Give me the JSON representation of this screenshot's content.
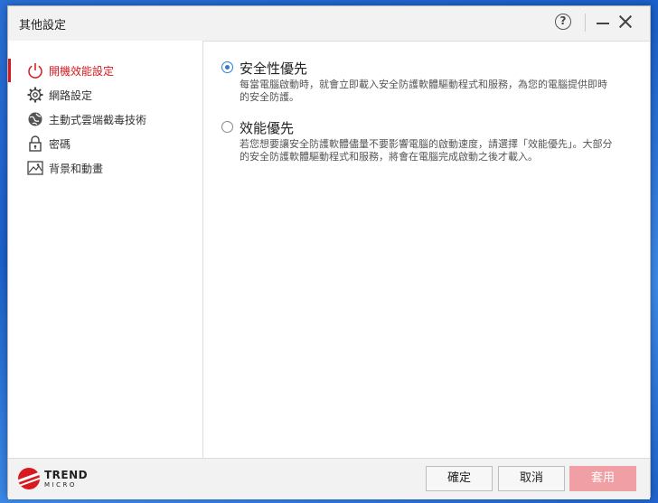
{
  "window": {
    "title": "其他設定"
  },
  "sidebar": {
    "items": [
      {
        "label": "開機效能設定",
        "icon": "power-icon",
        "active": true
      },
      {
        "label": "網路設定",
        "icon": "gear-icon",
        "active": false
      },
      {
        "label": "主動式雲端截毒技術",
        "icon": "globe-icon",
        "active": false
      },
      {
        "label": "密碼",
        "icon": "lock-icon",
        "active": false
      },
      {
        "label": "背景和動畫",
        "icon": "picture-icon",
        "active": false
      }
    ]
  },
  "main": {
    "options": [
      {
        "title": "安全性優先",
        "description": "每當電腦啟動時，就會立即載入安全防護軟體驅動程式和服務，為您的電腦提供即時的安全防護。",
        "selected": true
      },
      {
        "title": "效能優先",
        "description": "若您想要讓安全防護軟體儘量不要影響電腦的啟動速度，請選擇「效能優先」。大部分的安全防護軟體驅動程式和服務，將會在電腦完成啟動之後才載入。",
        "selected": false
      }
    ]
  },
  "footer": {
    "brand_line1": "TREND",
    "brand_line2": "MICRO",
    "ok_label": "確定",
    "cancel_label": "取消",
    "apply_label": "套用"
  },
  "colors": {
    "accent": "#d71920",
    "radio": "#2e7bd6",
    "apply_disabled": "#f0a0a4"
  }
}
